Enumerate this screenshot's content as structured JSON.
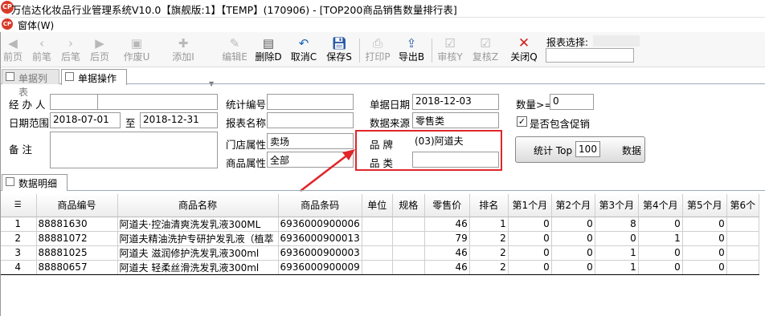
{
  "window": {
    "title": "万信达化妆品行业管理系统V10.0【旗舰版:1】【TEMP】(170906) - [TOP200商品销售数量排行表]",
    "logo_text": "CP"
  },
  "menubar": {
    "window_menu": "窗体(W)"
  },
  "toolbar": {
    "buttons": [
      {
        "label": "前页",
        "icon": "first-page"
      },
      {
        "label": "前笔",
        "icon": "prev-record"
      },
      {
        "label": "后笔",
        "icon": "next-record"
      },
      {
        "label": "后页",
        "icon": "last-page"
      },
      {
        "label": "作废U",
        "icon": "void"
      },
      {
        "label": "添加I",
        "icon": "add"
      },
      {
        "label": "编辑E",
        "icon": "edit"
      },
      {
        "label": "删除D",
        "icon": "delete"
      },
      {
        "label": "取消C",
        "icon": "undo"
      },
      {
        "label": "保存S",
        "icon": "save"
      },
      {
        "label": "打印P",
        "icon": "print"
      },
      {
        "label": "导出B",
        "icon": "export"
      },
      {
        "label": "审核Y",
        "icon": "approve"
      },
      {
        "label": "复核Z",
        "icon": "recheck"
      },
      {
        "label": "关闭Q",
        "icon": "close"
      }
    ],
    "report_select_label": "报表选择:",
    "report_select_value": ""
  },
  "tabs_top": {
    "list": "单据列表",
    "operate": "单据操作"
  },
  "form": {
    "handler_label": "经 办 人",
    "handler_value": "",
    "date_range_label": "日期范围",
    "date_from": "2018-07-01",
    "date_to_label": "至",
    "date_to": "2018-12-31",
    "remark_label": "备    注",
    "remark_value": "",
    "stat_no_label": "统计编号",
    "stat_no_value": "",
    "report_name_label": "报表名称",
    "report_name_value": "",
    "store_attr_label": "门店属性",
    "store_attr_value": "卖场",
    "product_attr_label": "商品属性",
    "product_attr_value": "全部",
    "doc_date_label": "单据日期",
    "doc_date_value": "2018-12-03",
    "source_label": "数据来源",
    "source_value": "零售类",
    "brand_label": "品    牌",
    "brand_value": "(03)阿道夫",
    "category_label": "品    类",
    "category_value": "",
    "qty_label": "数量>=",
    "qty_value": "0",
    "promo_label": "是否包含促销",
    "promo_checked": "✓",
    "stat_btn_prefix": "统计 Top",
    "stat_btn_top": "100",
    "stat_btn_suffix": "数据"
  },
  "tabs_bottom": {
    "detail": "数据明细"
  },
  "grid": {
    "headers": [
      "商品编号",
      "商品名称",
      "商品条码",
      "单位",
      "规格",
      "零售价",
      "排名",
      "第1个月",
      "第2个月",
      "第3个月",
      "第4个月",
      "第5个月",
      "第6个"
    ],
    "rows": [
      {
        "idx": "1",
        "code": "88881630",
        "name": "阿道夫·控油清爽洗发乳液300ML",
        "barcode": "6936000900006",
        "unit": "",
        "spec": "",
        "price": "46",
        "rank": "1",
        "m1": "0",
        "m2": "0",
        "m3": "8",
        "m4": "0",
        "m5": "0"
      },
      {
        "idx": "2",
        "code": "88881072",
        "name": "阿道夫精油洗护专研护发乳液（植萃",
        "barcode": "6936000900013",
        "unit": "",
        "spec": "",
        "price": "79",
        "rank": "2",
        "m1": "0",
        "m2": "0",
        "m3": "0",
        "m4": "1",
        "m5": "0"
      },
      {
        "idx": "3",
        "code": "88881025",
        "name": "阿道夫 滋润修护洗发乳液300ml",
        "barcode": "6936000900003",
        "unit": "",
        "spec": "",
        "price": "46",
        "rank": "2",
        "m1": "0",
        "m2": "0",
        "m3": "1",
        "m4": "0",
        "m5": "0"
      },
      {
        "idx": "4",
        "code": "88880657",
        "name": "阿道夫 轻柔丝滑洗发乳液300ml",
        "barcode": "6936000900009",
        "unit": "",
        "spec": "",
        "price": "46",
        "rank": "2",
        "m1": "0",
        "m2": "0",
        "m3": "1",
        "m4": "0",
        "m5": "0"
      }
    ]
  },
  "colors": {
    "highlight_box": "#e0262a",
    "logo": "#d83a2a",
    "close_icon": "#d0211d"
  }
}
